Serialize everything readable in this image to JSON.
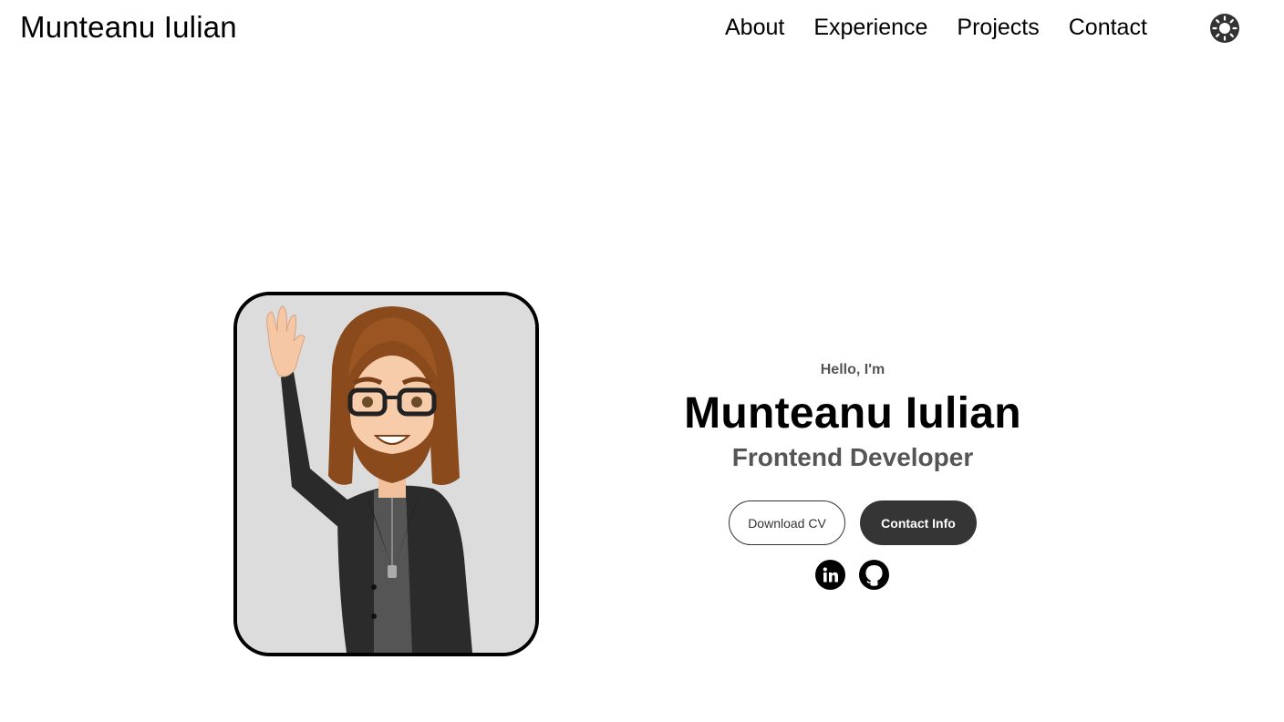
{
  "header": {
    "logo": "Munteanu Iulian",
    "nav": [
      "About",
      "Experience",
      "Projects",
      "Contact"
    ],
    "theme_icon": "sun-icon"
  },
  "hero": {
    "greeting": "Hello, I'm",
    "name": "Munteanu Iulian",
    "role": "Frontend Developer",
    "buttons": {
      "download": "Download CV",
      "contact": "Contact Info"
    },
    "socials": [
      "linkedin-icon",
      "github-icon"
    ],
    "avatar_icon": "cartoon-avatar-waving"
  },
  "colors": {
    "accent_dark": "#353535",
    "avatar_bg": "#dcdcdc",
    "text_muted": "#555555"
  }
}
